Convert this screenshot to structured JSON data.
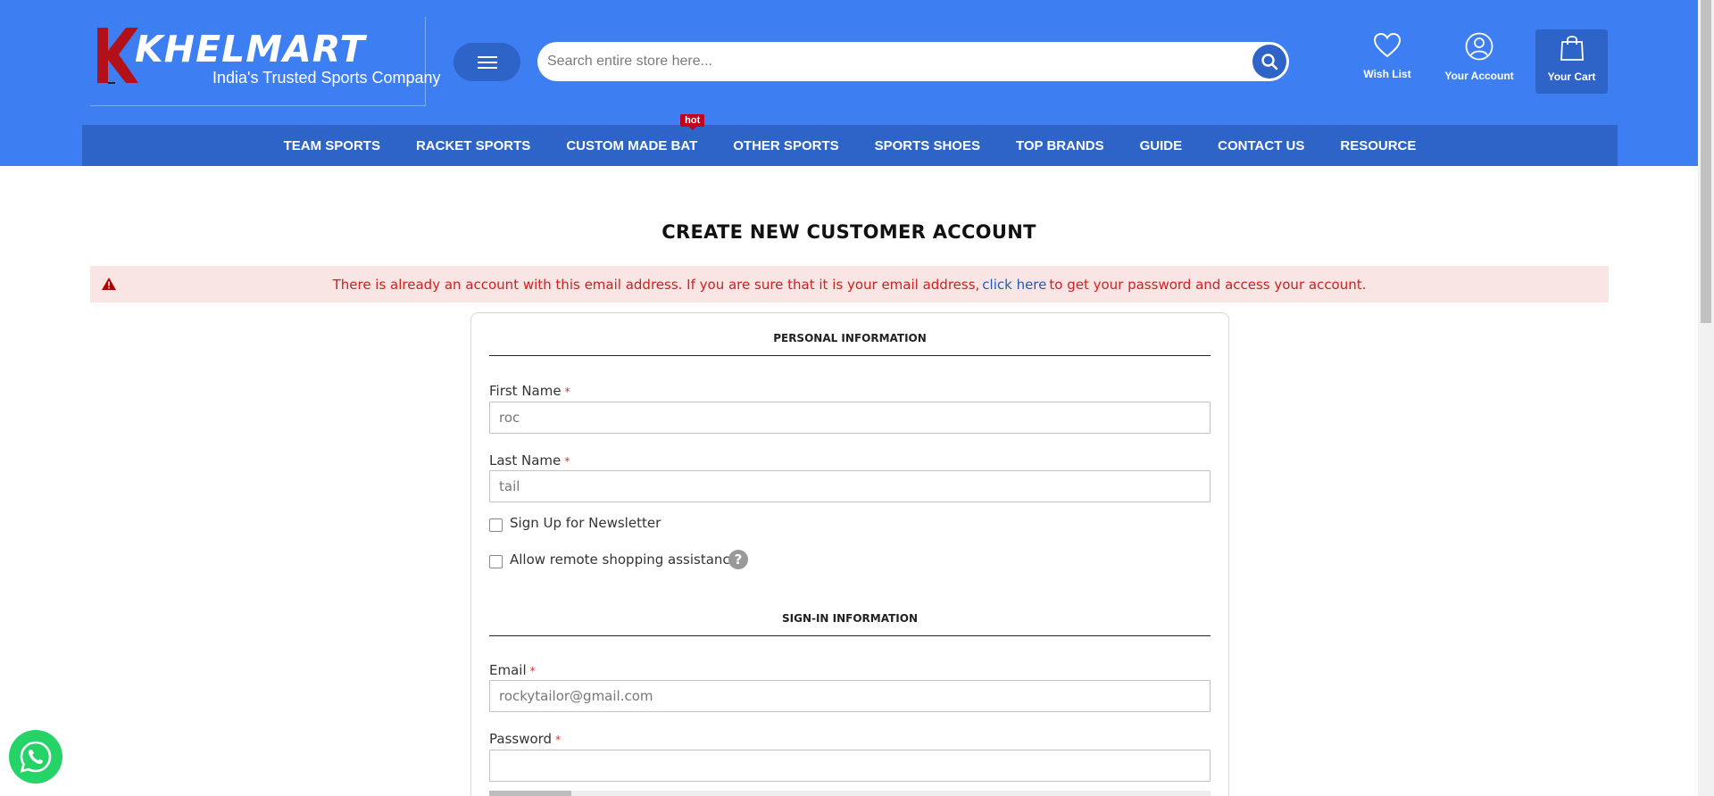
{
  "header": {
    "logo_name": "KHELMART",
    "logo_tagline": "India's Trusted Sports Company",
    "search_placeholder": "Search entire store here...",
    "wishlist_label": "Wish List",
    "account_label": "Your Account",
    "cart_label": "Your Cart",
    "brand_color": "#3d7ef2",
    "nav_color": "#2e63c7"
  },
  "nav": {
    "items": [
      {
        "label": "TEAM SPORTS"
      },
      {
        "label": "RACKET SPORTS"
      },
      {
        "label": "CUSTOM MADE BAT",
        "badge": "hot"
      },
      {
        "label": "OTHER SPORTS"
      },
      {
        "label": "SPORTS SHOES"
      },
      {
        "label": "TOP BRANDS"
      },
      {
        "label": "GUIDE"
      },
      {
        "label": "CONTACT US"
      },
      {
        "label": "RESOURCE"
      }
    ]
  },
  "page": {
    "title": "CREATE NEW CUSTOMER ACCOUNT"
  },
  "alert": {
    "text_before": "There is already an account with this email address. If you are sure that it is your email address,",
    "link_text": "click here",
    "text_after": "to get your password and access your account.",
    "color": "#d02020"
  },
  "form": {
    "personal_title": "PERSONAL INFORMATION",
    "first_name_label": "First Name",
    "first_name_value": "roc",
    "last_name_label": "Last Name",
    "last_name_value": "tail",
    "newsletter_label": "Sign Up for Newsletter",
    "remote_assist_label": "Allow remote shopping assistance",
    "help_glyph": "?",
    "signin_title": "SIGN-IN INFORMATION",
    "email_label": "Email",
    "email_value": "rockytailor@gmail.com",
    "password_label": "Password",
    "password_value": "",
    "required_mark": "*"
  },
  "icons": {
    "menu": "hamburger-icon",
    "search": "search-icon",
    "wishlist": "heart-icon",
    "account": "user-icon",
    "cart": "shopping-bag-icon",
    "alert": "warning-icon",
    "whatsapp": "whatsapp-icon"
  }
}
